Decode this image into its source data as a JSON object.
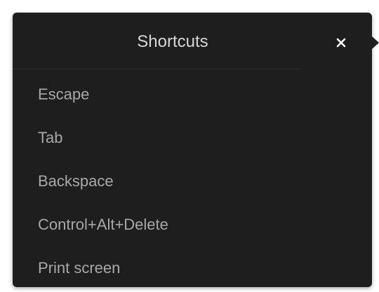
{
  "popover": {
    "title": "Shortcuts",
    "close_icon": "close-icon",
    "items": [
      {
        "label": "Escape"
      },
      {
        "label": "Tab"
      },
      {
        "label": "Backspace"
      },
      {
        "label": "Control+Alt+Delete"
      },
      {
        "label": "Print screen"
      }
    ]
  },
  "colors": {
    "background": "#1e1e1e",
    "title_text": "#d6d6d6",
    "item_text": "#a8a8a8",
    "close_icon": "#ffffff"
  }
}
